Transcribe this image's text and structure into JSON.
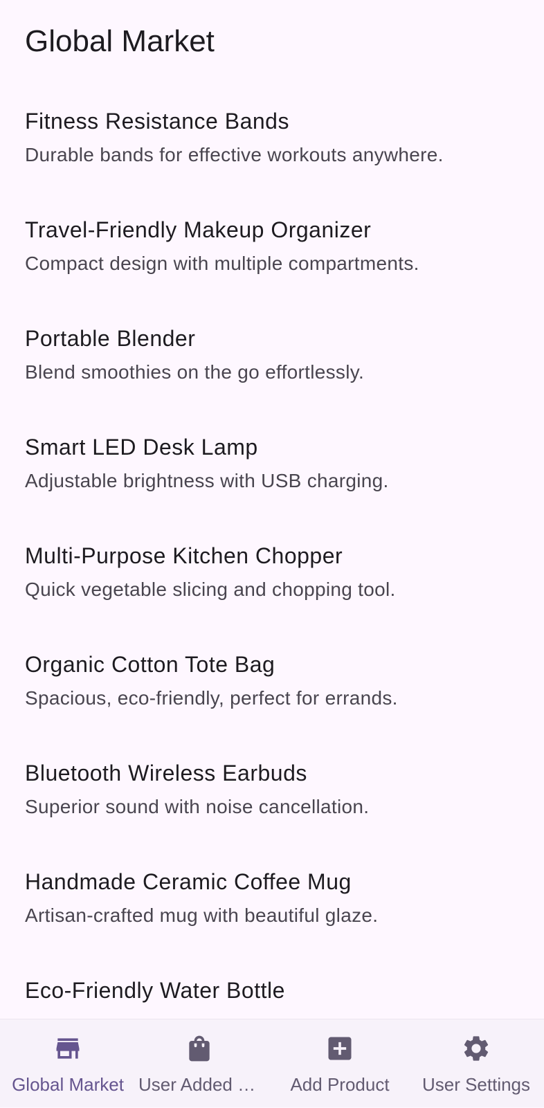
{
  "app_bar": {
    "title": "Global Market"
  },
  "products": [
    {
      "name": "Fitness Resistance Bands",
      "description": "Durable bands for effective workouts anywhere."
    },
    {
      "name": "Travel-Friendly Makeup Organizer",
      "description": "Compact design with multiple compartments."
    },
    {
      "name": "Portable Blender",
      "description": "Blend smoothies on the go effortlessly."
    },
    {
      "name": "Smart LED Desk Lamp",
      "description": "Adjustable brightness with USB charging."
    },
    {
      "name": "Multi-Purpose Kitchen Chopper",
      "description": "Quick vegetable slicing and chopping tool."
    },
    {
      "name": "Organic Cotton Tote Bag",
      "description": "Spacious, eco-friendly, perfect for errands."
    },
    {
      "name": "Bluetooth Wireless Earbuds",
      "description": "Superior sound with noise cancellation."
    },
    {
      "name": "Handmade Ceramic Coffee Mug",
      "description": "Artisan-crafted mug with beautiful glaze."
    },
    {
      "name": "Eco-Friendly Water Bottle",
      "description": ""
    }
  ],
  "bottom_nav": {
    "items": [
      {
        "label": "Global Market",
        "icon": "store-icon",
        "active": true
      },
      {
        "label": "User Added Products",
        "icon": "shopping-bag-icon",
        "active": false
      },
      {
        "label": "Add Product",
        "icon": "add-box-icon",
        "active": false
      },
      {
        "label": "User Settings",
        "icon": "gear-icon",
        "active": false
      }
    ]
  },
  "colors": {
    "background": "#FEF7FF",
    "nav_background": "#F7F2FA",
    "active": "#65558F",
    "inactive": "#625B71",
    "title_text": "#1D1B20",
    "secondary_text": "#49454F"
  }
}
